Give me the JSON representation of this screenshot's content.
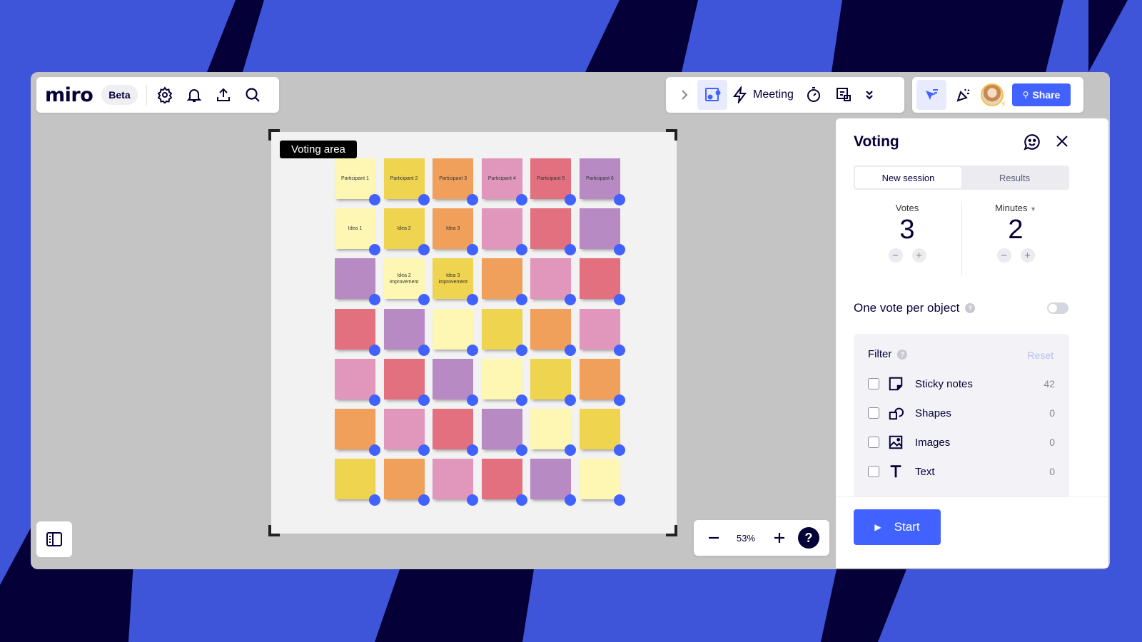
{
  "brand": {
    "logo": "miro",
    "badge": "Beta"
  },
  "toolbar_left": {
    "icons": [
      "settings-icon",
      "bell-icon",
      "upload-icon",
      "search-icon"
    ]
  },
  "toolbar_meeting": {
    "meeting_label": "Meeting",
    "icons": [
      "chevron-right-icon",
      "frame-presence-icon",
      "lightning-icon",
      "timer-icon",
      "present-icon",
      "chevron-double-down-icon"
    ]
  },
  "toolbar_right": {
    "share_label": "Share",
    "icons": [
      "cursor-filter-icon",
      "celebrate-icon",
      "avatar"
    ]
  },
  "frame": {
    "label": "Voting area"
  },
  "stickies": {
    "colors": {
      "lightyellow": "#fef7b3",
      "yellow": "#efd44f",
      "orange": "#f0a05a",
      "pink": "#e196bb",
      "red": "#e2707e",
      "purple": "#b88ac4"
    },
    "rows": [
      [
        {
          "c": "lightyellow",
          "t": "Participant 1"
        },
        {
          "c": "yellow",
          "t": "Participant 2"
        },
        {
          "c": "orange",
          "t": "Participant 3"
        },
        {
          "c": "pink",
          "t": "Participant 4"
        },
        {
          "c": "red",
          "t": "Participant 5"
        },
        {
          "c": "purple",
          "t": "Participant 6"
        }
      ],
      [
        {
          "c": "lightyellow",
          "t": "Idea 1"
        },
        {
          "c": "yellow",
          "t": "Idea 2"
        },
        {
          "c": "orange",
          "t": "Idea 3"
        },
        {
          "c": "pink",
          "t": ""
        },
        {
          "c": "red",
          "t": ""
        },
        {
          "c": "purple",
          "t": ""
        }
      ],
      [
        {
          "c": "purple",
          "t": ""
        },
        {
          "c": "lightyellow",
          "t": "Idea 2 improvement"
        },
        {
          "c": "yellow",
          "t": "Idea 3 improvement"
        },
        {
          "c": "orange",
          "t": ""
        },
        {
          "c": "pink",
          "t": ""
        },
        {
          "c": "red",
          "t": ""
        }
      ],
      [
        {
          "c": "red",
          "t": ""
        },
        {
          "c": "purple",
          "t": ""
        },
        {
          "c": "lightyellow",
          "t": ""
        },
        {
          "c": "yellow",
          "t": ""
        },
        {
          "c": "orange",
          "t": ""
        },
        {
          "c": "pink",
          "t": ""
        }
      ],
      [
        {
          "c": "pink",
          "t": ""
        },
        {
          "c": "red",
          "t": ""
        },
        {
          "c": "purple",
          "t": ""
        },
        {
          "c": "lightyellow",
          "t": ""
        },
        {
          "c": "yellow",
          "t": ""
        },
        {
          "c": "orange",
          "t": ""
        }
      ],
      [
        {
          "c": "orange",
          "t": ""
        },
        {
          "c": "pink",
          "t": ""
        },
        {
          "c": "red",
          "t": ""
        },
        {
          "c": "purple",
          "t": ""
        },
        {
          "c": "lightyellow",
          "t": ""
        },
        {
          "c": "yellow",
          "t": ""
        }
      ],
      [
        {
          "c": "yellow",
          "t": ""
        },
        {
          "c": "orange",
          "t": ""
        },
        {
          "c": "pink",
          "t": ""
        },
        {
          "c": "red",
          "t": ""
        },
        {
          "c": "purple",
          "t": ""
        },
        {
          "c": "lightyellow",
          "t": ""
        }
      ]
    ]
  },
  "zoom_bar": {
    "zoom_level": "53%",
    "help": "?"
  },
  "voting": {
    "title": "Voting",
    "tabs": [
      {
        "label": "New session",
        "active": true
      },
      {
        "label": "Results",
        "active": false
      }
    ],
    "votes": {
      "label": "Votes",
      "value": "3"
    },
    "minutes": {
      "label": "Minutes",
      "value": "2"
    },
    "one_vote_per_object": {
      "label": "One vote per object",
      "enabled": false
    },
    "filter": {
      "title": "Filter",
      "reset_label": "Reset",
      "items": [
        {
          "label": "Sticky notes",
          "count": "42",
          "icon": "sticky-note-icon",
          "checked": false
        },
        {
          "label": "Shapes",
          "count": "0",
          "icon": "shapes-icon",
          "checked": false
        },
        {
          "label": "Images",
          "count": "0",
          "icon": "image-icon",
          "checked": false
        },
        {
          "label": "Text",
          "count": "0",
          "icon": "text-icon",
          "checked": false
        }
      ]
    },
    "start_label": "Start"
  },
  "theme": {
    "accent": "#4262ff",
    "ink": "#050038",
    "background_blue": "#3f55d9",
    "canvas": "#c4c4c4"
  }
}
